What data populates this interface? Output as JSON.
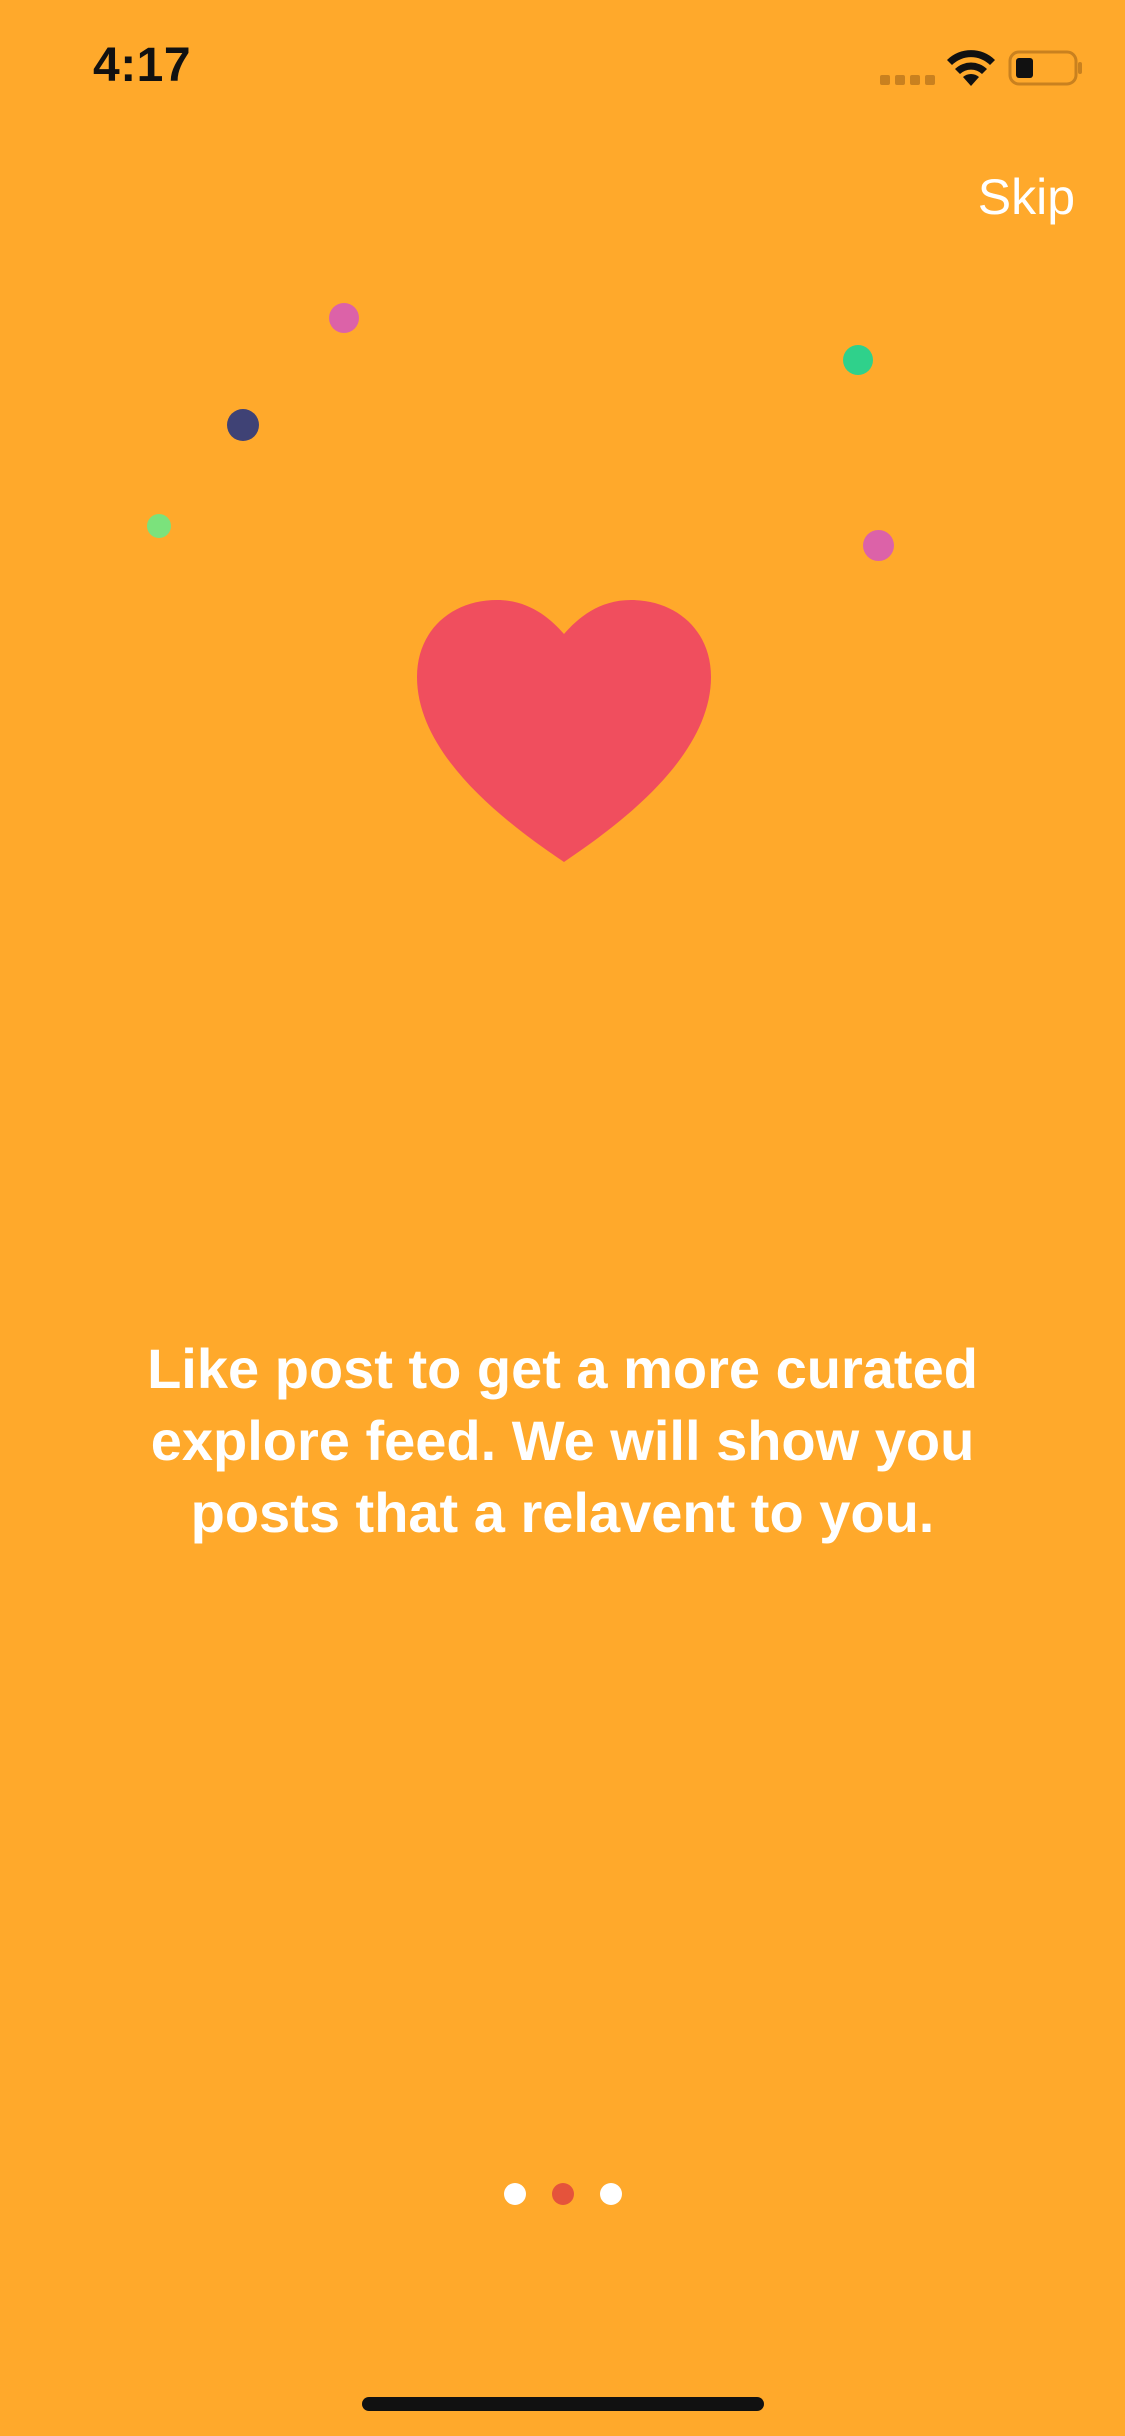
{
  "status_bar": {
    "time": "4:17",
    "icons": [
      "signal-icon",
      "wifi-icon",
      "battery-icon"
    ]
  },
  "header": {
    "skip_label": "Skip"
  },
  "illustration": {
    "main_icon": "heart-icon",
    "heart_color": "#F04E5E",
    "confetti_colors": [
      "#DC62A8",
      "#3F4275",
      "#2FD18B",
      "#7BE27C"
    ]
  },
  "onboarding": {
    "description": "Like post to get a more curated explore feed. We will show you posts that a relavent to you."
  },
  "pagination": {
    "current_page": 2,
    "total_pages": 3,
    "active_color": "#E5533B",
    "inactive_color": "#FFFFFF"
  },
  "colors": {
    "background": "#FFA92B",
    "text": "#FFFFFF"
  }
}
